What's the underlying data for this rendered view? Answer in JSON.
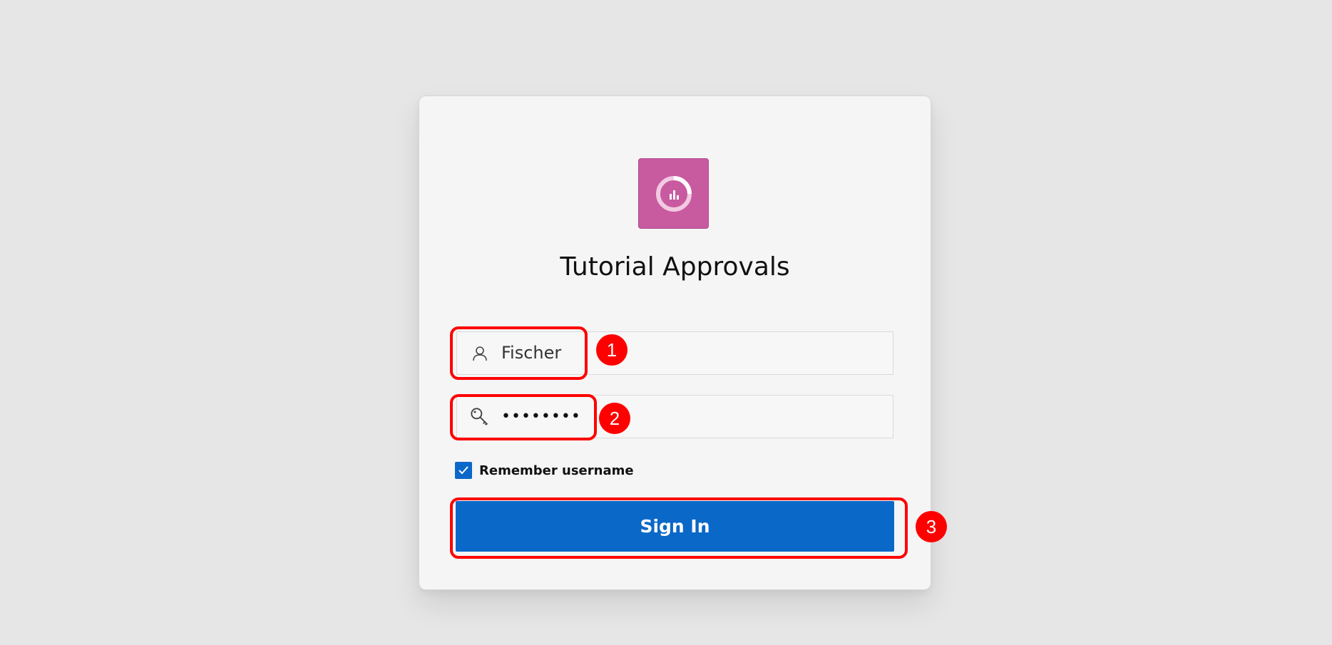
{
  "app": {
    "title": "Tutorial Approvals",
    "icon": "donut-chart-icon",
    "icon_color": "#c85aa0"
  },
  "login": {
    "username_value": "Fischer",
    "username_icon": "user-icon",
    "password_value": "••••••••",
    "password_icon": "key-icon",
    "remember_label": "Remember username",
    "remember_checked": true,
    "signin_label": "Sign In"
  },
  "annotations": [
    {
      "label": "1"
    },
    {
      "label": "2"
    },
    {
      "label": "3"
    }
  ],
  "colors": {
    "background": "#e6e6e6",
    "card": "#f5f5f5",
    "accent": "#0a68c9",
    "annotation": "#ff0000"
  }
}
